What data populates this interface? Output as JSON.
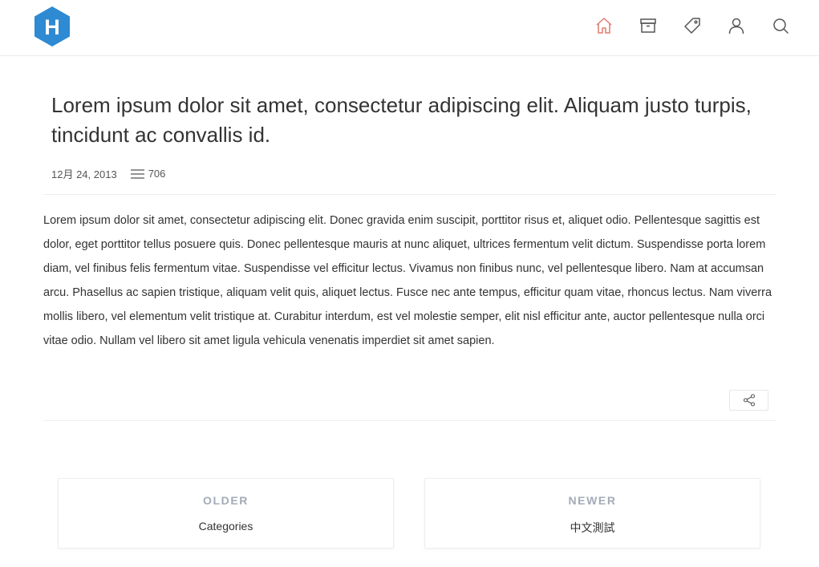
{
  "brand": {
    "logo_letter": "H",
    "logo_color": "#2e8ad3"
  },
  "nav": {
    "items": [
      {
        "name": "home",
        "icon": "home-icon",
        "active": true
      },
      {
        "name": "archive",
        "icon": "archive-icon",
        "active": false
      },
      {
        "name": "tags",
        "icon": "tag-icon",
        "active": false
      },
      {
        "name": "about",
        "icon": "user-icon",
        "active": false
      },
      {
        "name": "search",
        "icon": "search-icon",
        "active": false
      }
    ],
    "active_color": "#e07a6f",
    "icon_color": "#555555"
  },
  "post": {
    "title": "Lorem ipsum dolor sit amet, consectetur adipiscing elit. Aliquam justo turpis, tincidunt ac convallis id.",
    "date": "12月 24, 2013",
    "word_count": "706",
    "body": "Lorem ipsum dolor sit amet, consectetur adipiscing elit. Donec gravida enim suscipit, porttitor risus et, aliquet odio. Pellentesque sagittis est dolor, eget porttitor tellus posuere quis. Donec pellentesque mauris at nunc aliquet, ultrices fermentum velit dictum. Suspendisse porta lorem diam, vel finibus felis fermentum vitae. Suspendisse vel efficitur lectus. Vivamus non finibus nunc, vel pellentesque libero. Nam at accumsan arcu. Phasellus ac sapien tristique, aliquam velit quis, aliquet lectus. Fusce nec ante tempus, efficitur quam vitae, rhoncus lectus. Nam viverra mollis libero, vel elementum velit tristique at. Curabitur interdum, est vel molestie semper, elit nisl efficitur ante, auctor pellentesque nulla orci vitae odio. Nullam vel libero sit amet ligula vehicula venenatis imperdiet sit amet sapien."
  },
  "post_nav": {
    "older": {
      "caption": "OLDER",
      "title": "Categories"
    },
    "newer": {
      "caption": "NEWER",
      "title": "中文測試"
    }
  }
}
